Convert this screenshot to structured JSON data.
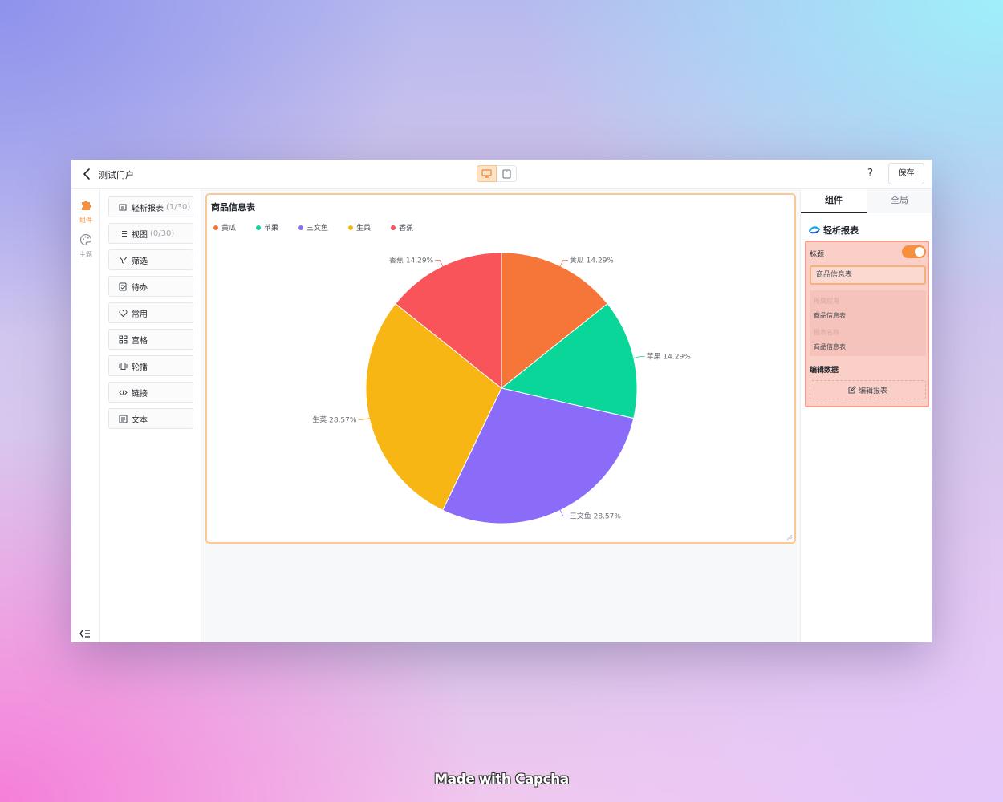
{
  "topbar": {
    "title": "测试门户",
    "help": "?",
    "save_label": "保存"
  },
  "rail": {
    "items": [
      {
        "label": "组件",
        "icon": "puzzle-icon",
        "active": true
      },
      {
        "label": "主题",
        "icon": "palette-icon",
        "active": false
      }
    ]
  },
  "palette": {
    "items": [
      {
        "label": "轻析报表",
        "count": "(1/30)",
        "icon": "report-icon"
      },
      {
        "label": "视图",
        "count": "(0/30)",
        "icon": "list-icon"
      },
      {
        "label": "筛选",
        "count": "",
        "icon": "filter-icon"
      },
      {
        "label": "待办",
        "count": "",
        "icon": "todo-icon"
      },
      {
        "label": "常用",
        "count": "",
        "icon": "heart-icon"
      },
      {
        "label": "宫格",
        "count": "",
        "icon": "grid-icon"
      },
      {
        "label": "轮播",
        "count": "",
        "icon": "carousel-icon"
      },
      {
        "label": "链接",
        "count": "",
        "icon": "code-icon"
      },
      {
        "label": "文本",
        "count": "",
        "icon": "text-icon"
      }
    ]
  },
  "chart_data": {
    "type": "pie",
    "title": "商品信息表",
    "legend_position": "top-left",
    "categories": [
      "黄瓜",
      "苹果",
      "三文鱼",
      "生菜",
      "香蕉"
    ],
    "values": [
      14.29,
      14.29,
      28.57,
      28.57,
      14.29
    ],
    "labels": [
      "黄瓜 14.29%",
      "苹果 14.29%",
      "三文鱼 28.57%",
      "生菜 28.57%",
      "香蕉 14.29%"
    ],
    "colors": [
      "#f6763a",
      "#0ad69a",
      "#8b6cf9",
      "#f7b614",
      "#f8545a"
    ]
  },
  "props": {
    "tabs": [
      "组件",
      "全局"
    ],
    "component_name": "轻析报表",
    "title_label": "标题",
    "title_enabled": true,
    "title_value": "商品信息表",
    "app_label": "所属应用",
    "app_value": "商品信息表",
    "report_label": "报表名称",
    "report_value": "商品信息表",
    "edit_section": "编辑数据",
    "edit_button": "编辑报表"
  },
  "watermark": "Made with Capcha",
  "colors": {
    "accent": "#f7903e",
    "highlight_border": "#f59c8e",
    "canvas_border": "#fbc795"
  }
}
